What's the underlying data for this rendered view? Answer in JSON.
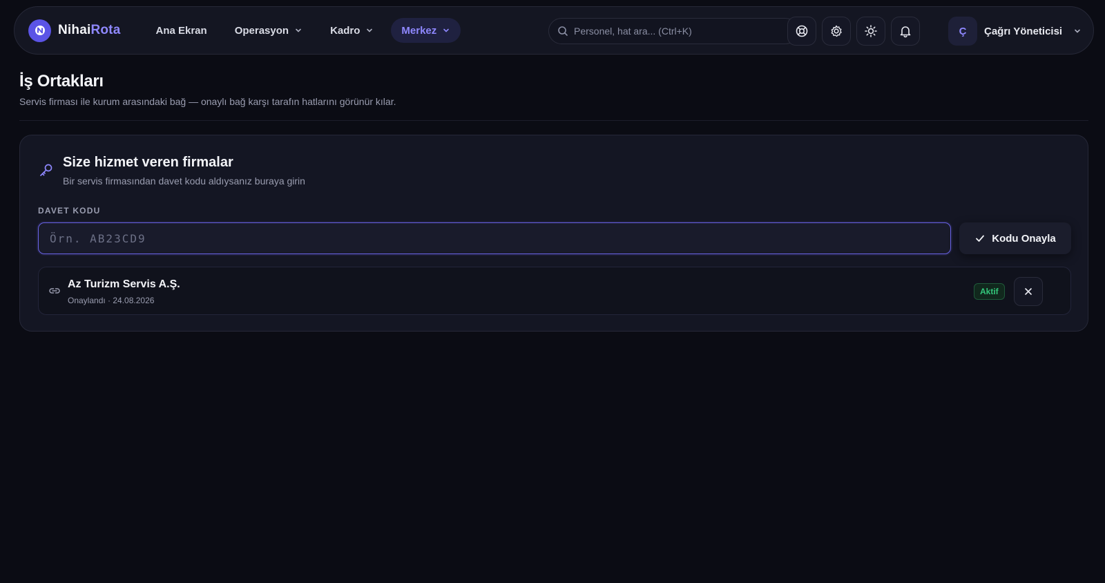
{
  "brand": {
    "name_part1": "Nihai",
    "name_part2": "Rota",
    "mark": "N"
  },
  "nav": {
    "items": [
      {
        "label": "Ana Ekran",
        "has_dropdown": false
      },
      {
        "label": "Operasyon",
        "has_dropdown": true
      },
      {
        "label": "Kadro",
        "has_dropdown": true
      },
      {
        "label": "Merkez",
        "has_dropdown": true,
        "active": true
      }
    ]
  },
  "search": {
    "placeholder": "Personel, hat ara...  (Ctrl+K)"
  },
  "toolbar_icons": [
    "help-icon",
    "gear-icon",
    "sun-icon",
    "bell-icon"
  ],
  "user": {
    "initial": "Ç",
    "name": "Çağrı Yöneticisi"
  },
  "page": {
    "title": "İş Ortakları",
    "subtitle": "Servis firması ile kurum arasındaki bağ — onaylı bağ karşı tarafın hatlarını görünür kılar."
  },
  "card": {
    "title": "Size hizmet veren firmalar",
    "subtitle": "Bir servis firmasından davet kodu aldıysanız buraya girin",
    "field_label": "DAVET KODU",
    "input_value": "",
    "input_placeholder": "Örn. AB23CD9",
    "confirm_label": "Kodu Onayla"
  },
  "partners": [
    {
      "name": "Az Turizm Servis A.Ş.",
      "meta": "Onaylandı · 24.08.2026",
      "status": "Aktif"
    }
  ],
  "colors": {
    "accent": "#8f88ff",
    "brand": "#5b54e6",
    "status_active": "#34c77b",
    "background": "#0b0c14"
  }
}
